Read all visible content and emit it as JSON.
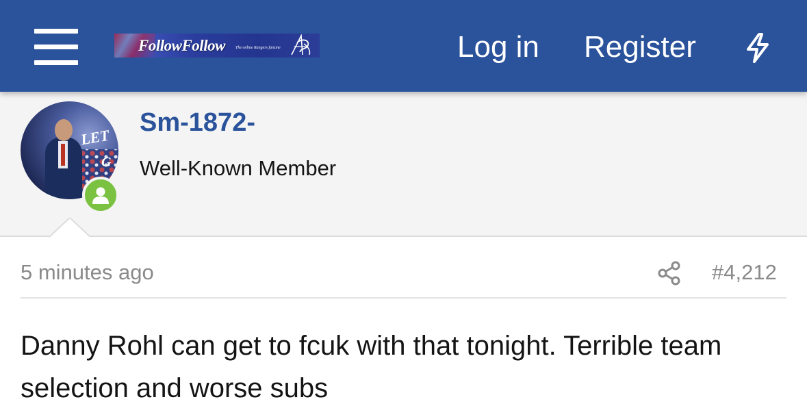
{
  "header": {
    "logo_name": "FollowFollow",
    "logo_tagline": "The online Rangers fanzine",
    "login_label": "Log in",
    "register_label": "Register",
    "colors": {
      "bar": "#2b539b",
      "text": "#ffffff"
    }
  },
  "author": {
    "username": "Sm-1872-",
    "user_title": "Well-Known Member",
    "avatar_text_1": "LET",
    "avatar_text_2": "G",
    "online_status": "online",
    "colors": {
      "username": "#2b539b",
      "online": "#7cc242"
    }
  },
  "post": {
    "time": "5 minutes ago",
    "post_number": "#4,212",
    "body": "Danny Rohl can get to fcuk with that tonight. Terrible team selection and worse subs"
  }
}
